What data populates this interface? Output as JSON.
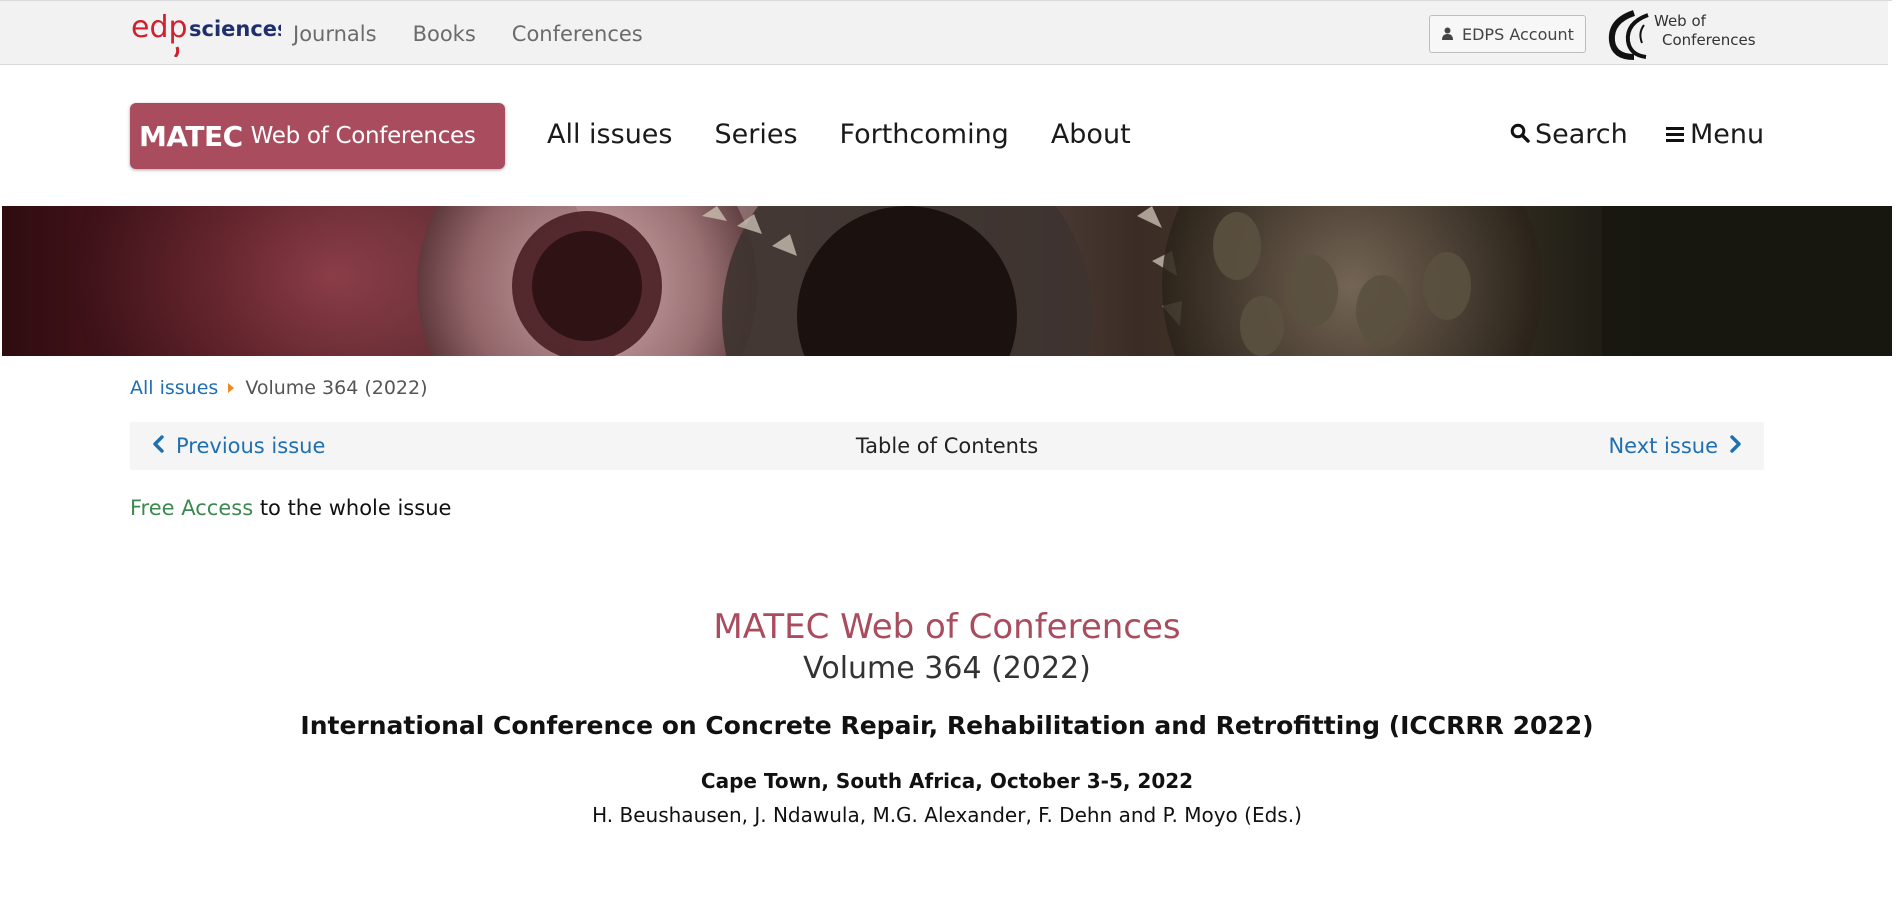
{
  "topbar": {
    "logo_text_left": "edp",
    "logo_text_right": "sciences",
    "nav": [
      "Journals",
      "Books",
      "Conferences"
    ],
    "account_label": "EDPS Account",
    "wc_logo_line1": "Web of",
    "wc_logo_line2": "Conferences"
  },
  "header": {
    "journal_logo_bold": "MATEC",
    "journal_logo_light": "Web of Conferences",
    "nav": [
      "All issues",
      "Series",
      "Forthcoming",
      "About"
    ],
    "search_label": "Search",
    "menu_label": "Menu"
  },
  "breadcrumb": {
    "link": "All issues",
    "current": "Volume 364 (2022)"
  },
  "issue_nav": {
    "prev": "Previous issue",
    "center": "Table of Contents",
    "next": "Next issue"
  },
  "free_access": {
    "highlight": "Free Access",
    "rest": " to the whole issue"
  },
  "issue_info": {
    "journal": "MATEC Web of Conferences",
    "volume": "Volume 364 (2022)",
    "conference": "International Conference on Concrete Repair, Rehabilitation and Retrofitting (ICCRRR 2022)",
    "location": "Cape Town, South Africa, October 3-5, 2022",
    "editors": "H. Beushausen, J. Ndawula, M.G. Alexander, F. Dehn and P. Moyo (Eds.)"
  },
  "colors": {
    "accent": "#a94c5e",
    "link": "#1f6fb2",
    "free_access": "#3c8a4f",
    "edp_red": "#d0202f",
    "edp_navy": "#1f2f6b"
  }
}
